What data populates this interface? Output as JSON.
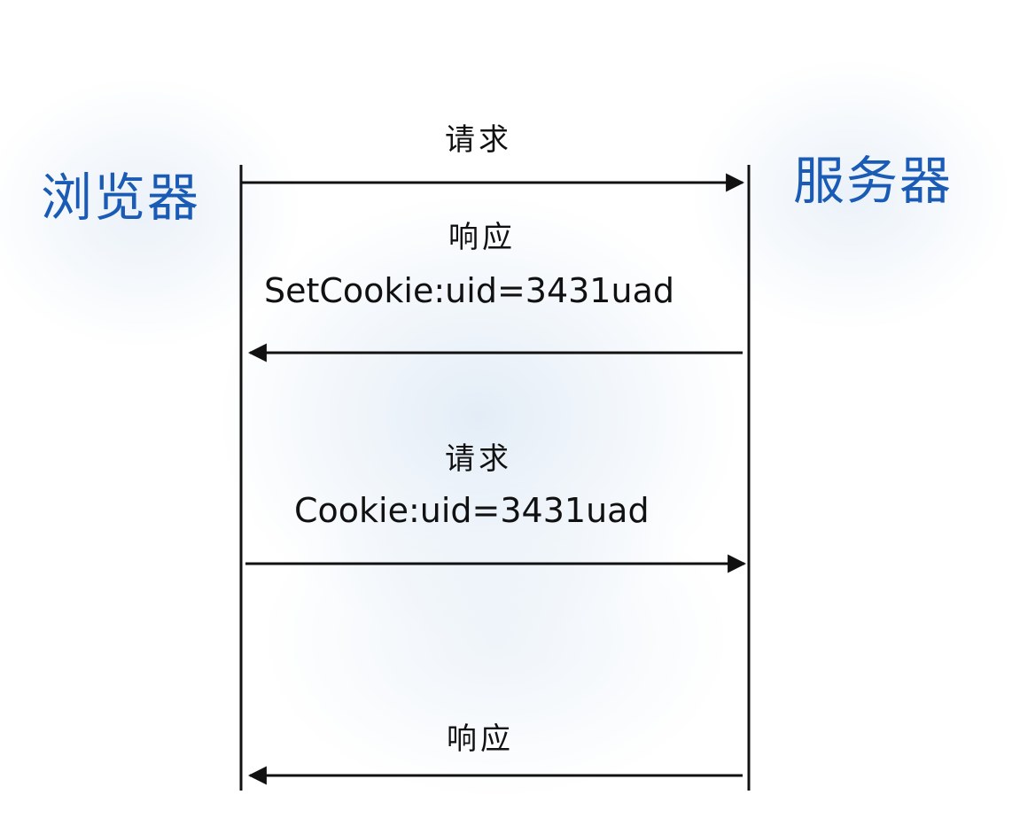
{
  "actors": {
    "left": "浏览器",
    "right": "服务器"
  },
  "messages": [
    {
      "direction": "browser-to-server",
      "label": "请求",
      "detail": ""
    },
    {
      "direction": "server-to-browser",
      "label": "响应",
      "detail": "SetCookie:uid=3431uad"
    },
    {
      "direction": "browser-to-server",
      "label": "请求",
      "detail": "Cookie:uid=3431uad"
    },
    {
      "direction": "server-to-browser",
      "label": "响应",
      "detail": ""
    }
  ],
  "colors": {
    "actor_text": "#1a5bb5",
    "line": "#111111"
  }
}
